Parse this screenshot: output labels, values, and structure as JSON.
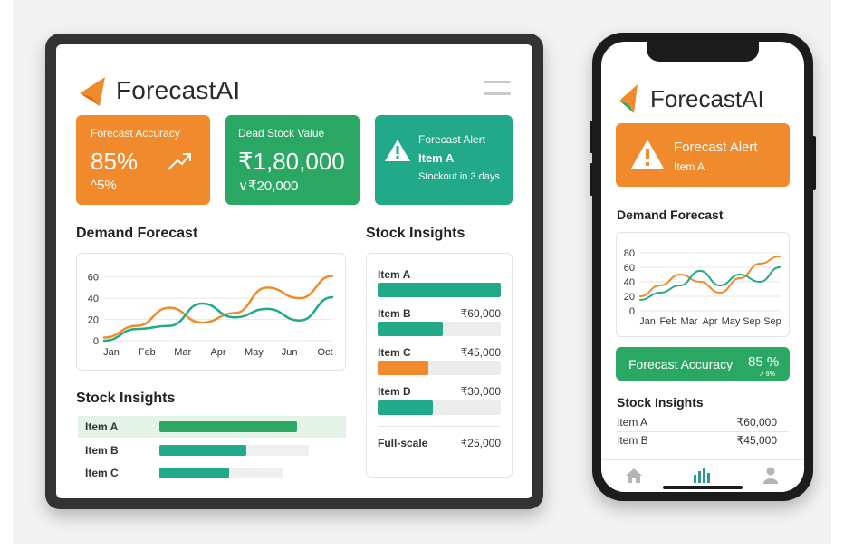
{
  "brand": {
    "name": "ForecastAI",
    "colors": {
      "orange": "#f08a2c",
      "green": "#2aa863",
      "teal": "#22a98a"
    }
  },
  "tablet": {
    "menu_icon": "hamburger-icon",
    "kpis": {
      "accuracy": {
        "title": "Forecast Accuracy",
        "value": "85%",
        "change": "^5%",
        "icon": "trend-up-icon"
      },
      "dead_stock": {
        "title": "Dead Stock Value",
        "value": "₹1,80,000",
        "change": "∨₹20,000"
      },
      "alert": {
        "title": "Forecast Alert",
        "item": "Item A",
        "detail": "Stockout in 3 days",
        "icon": "warning-icon"
      }
    },
    "demand_forecast": {
      "title": "Demand Forecast"
    },
    "stock_insights_right": {
      "title": "Stock Insights",
      "rows": [
        {
          "label": "Item A",
          "value": "",
          "fill": 1.0,
          "color": "#22a98a"
        },
        {
          "label": "Item B",
          "value": "₹60,000",
          "fill": 0.53,
          "color": "#22a98a"
        },
        {
          "label": "Item C",
          "value": "₹45,000",
          "fill": 0.41,
          "color": "#f08a2c"
        },
        {
          "label": "Item D",
          "value": "₹30,000",
          "fill": 0.45,
          "color": "#22a98a"
        }
      ],
      "footer": {
        "label": "Full-scale",
        "value": "₹25,000"
      }
    },
    "stock_insights_bottom": {
      "title": "Stock Insights",
      "rows": [
        {
          "label": "Item A",
          "fill": 1.0,
          "color": "#2aa863"
        },
        {
          "label": "Item B",
          "fill": 0.58,
          "color": "#22a98a"
        },
        {
          "label": "Item C",
          "fill": 0.56,
          "color": "#22a98a"
        }
      ]
    }
  },
  "phone": {
    "alert": {
      "title": "Forecast Alert",
      "item": "Item A",
      "icon": "warning-icon"
    },
    "demand_forecast": {
      "title": "Demand Forecast"
    },
    "accuracy": {
      "label": "Forecast Accuracy",
      "value": "85 %",
      "sub": "↗ 9%"
    },
    "stock_insights": {
      "title": "Stock Insights",
      "rows": [
        {
          "label": "Item A",
          "value": "₹60,000"
        },
        {
          "label": "Item B",
          "value": "₹45,000"
        }
      ]
    },
    "tabs": [
      {
        "name": "home-icon"
      },
      {
        "name": "bar-chart-icon"
      },
      {
        "name": "user-icon"
      }
    ]
  },
  "chart_data": [
    {
      "type": "line",
      "title": "Demand Forecast",
      "x": [
        "Jan",
        "Feb",
        "Mar",
        "Apr",
        "May",
        "Jun",
        "Oct"
      ],
      "yticks": [
        0,
        20,
        40,
        60
      ],
      "ylim": [
        0,
        70
      ],
      "grid": true,
      "series": [
        {
          "color": "#f08a2c",
          "values": [
            3,
            14,
            31,
            17,
            26,
            50,
            40,
            61
          ]
        },
        {
          "color": "#22a98a",
          "values": [
            0,
            11,
            14,
            35,
            22,
            30,
            19,
            41
          ]
        }
      ]
    },
    {
      "type": "line",
      "title": "Demand Forecast",
      "x": [
        "Jan",
        "Feb",
        "Mar",
        "Apr",
        "May",
        "Sep",
        "Sep"
      ],
      "yticks": [
        0,
        20,
        40,
        60,
        80
      ],
      "ylim": [
        0,
        85
      ],
      "grid": true,
      "series": [
        {
          "color": "#f08a2c",
          "values": [
            20,
            35,
            50,
            40,
            25,
            45,
            65,
            75
          ]
        },
        {
          "color": "#22a98a",
          "values": [
            15,
            25,
            35,
            55,
            35,
            50,
            40,
            60
          ]
        }
      ]
    }
  ]
}
